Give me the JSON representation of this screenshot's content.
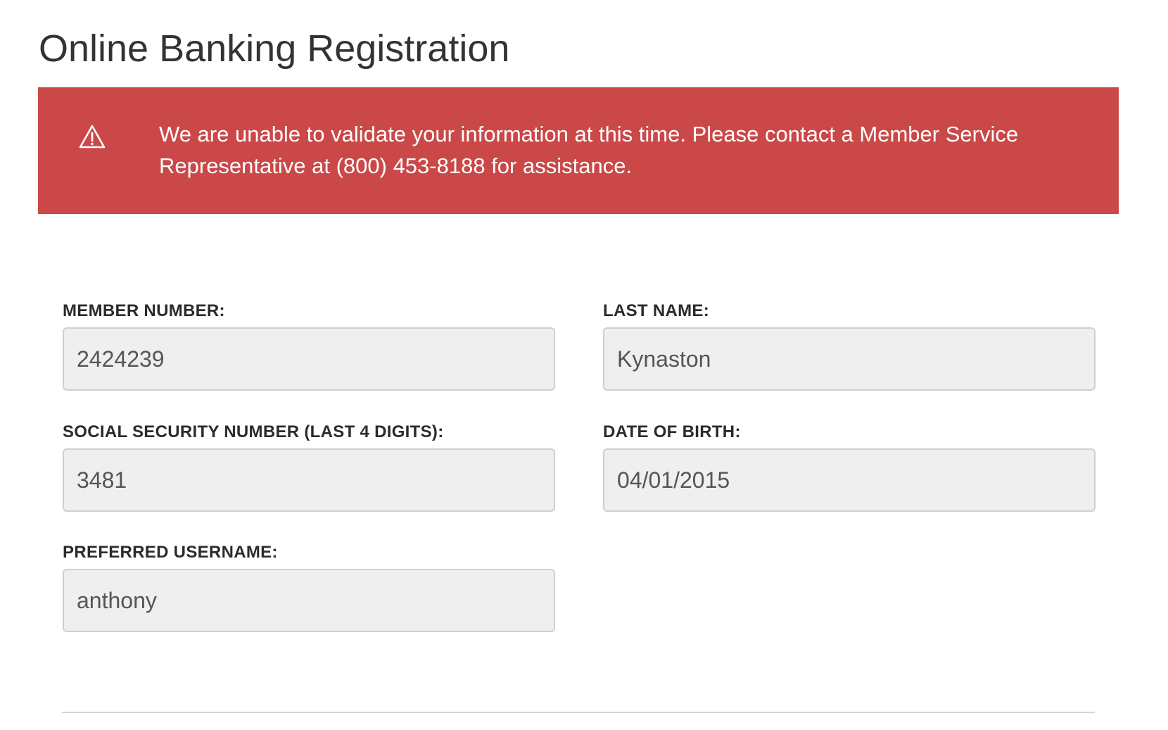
{
  "page": {
    "title": "Online Banking Registration"
  },
  "alert": {
    "icon": "warning-triangle-icon",
    "message": "We are unable to validate your information at this time. Please contact a Member Service Representative at (800) 453-8188 for assistance.",
    "background_color": "#cb4848",
    "text_color": "#ffffff"
  },
  "form": {
    "member_number": {
      "label": "MEMBER NUMBER:",
      "value": "2424239"
    },
    "last_name": {
      "label": "LAST NAME:",
      "value": "Kynaston"
    },
    "ssn_last4": {
      "label": "SOCIAL SECURITY NUMBER (LAST 4 DIGITS):",
      "value": "3481"
    },
    "date_of_birth": {
      "label": "DATE OF BIRTH:",
      "value": "04/01/2015"
    },
    "preferred_username": {
      "label": "PREFERRED USERNAME:",
      "value": "anthony"
    }
  }
}
